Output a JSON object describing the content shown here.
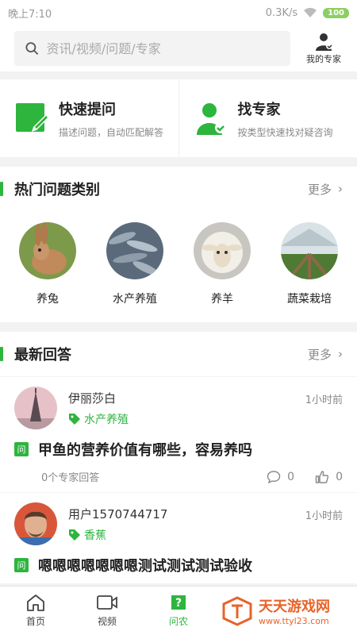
{
  "status_bar": {
    "time": "晚上7:10",
    "network": "0.3K/s",
    "battery": "100"
  },
  "header": {
    "search_placeholder": "资讯/视频/问题/专家",
    "expert_label": "我的专家"
  },
  "quick": [
    {
      "title": "快速提问",
      "subtitle": "描述问题，自动匹配解答"
    },
    {
      "title": "找专家",
      "subtitle": "按类型快速找对疑咨询"
    }
  ],
  "hot_categories": {
    "title": "热门问题类别",
    "more": "更多",
    "items": [
      {
        "label": "养兔"
      },
      {
        "label": "水产养殖"
      },
      {
        "label": "养羊"
      },
      {
        "label": "蔬菜栽培"
      }
    ]
  },
  "latest_answers": {
    "title": "最新回答",
    "more": "更多",
    "items": [
      {
        "user": "伊丽莎白",
        "tag": "水产养殖",
        "time": "1小时前",
        "question": "甲鱼的营养价值有哪些，容易养吗",
        "expert_answers": "0个专家回答",
        "comments": "0",
        "likes": "0"
      },
      {
        "user": "用户1570744717",
        "tag": "香蕉",
        "time": "1小时前",
        "question": "嗯嗯嗯嗯嗯嗯嗯测试测试测试验收"
      }
    ]
  },
  "bottom_nav": [
    {
      "label": "首页"
    },
    {
      "label": "视频"
    },
    {
      "label": "问农"
    }
  ],
  "watermark": {
    "title": "天天游戏网",
    "url": "www.ttyl23.com"
  },
  "colors": {
    "accent": "#2db53e",
    "watermark": "#e8632a"
  }
}
